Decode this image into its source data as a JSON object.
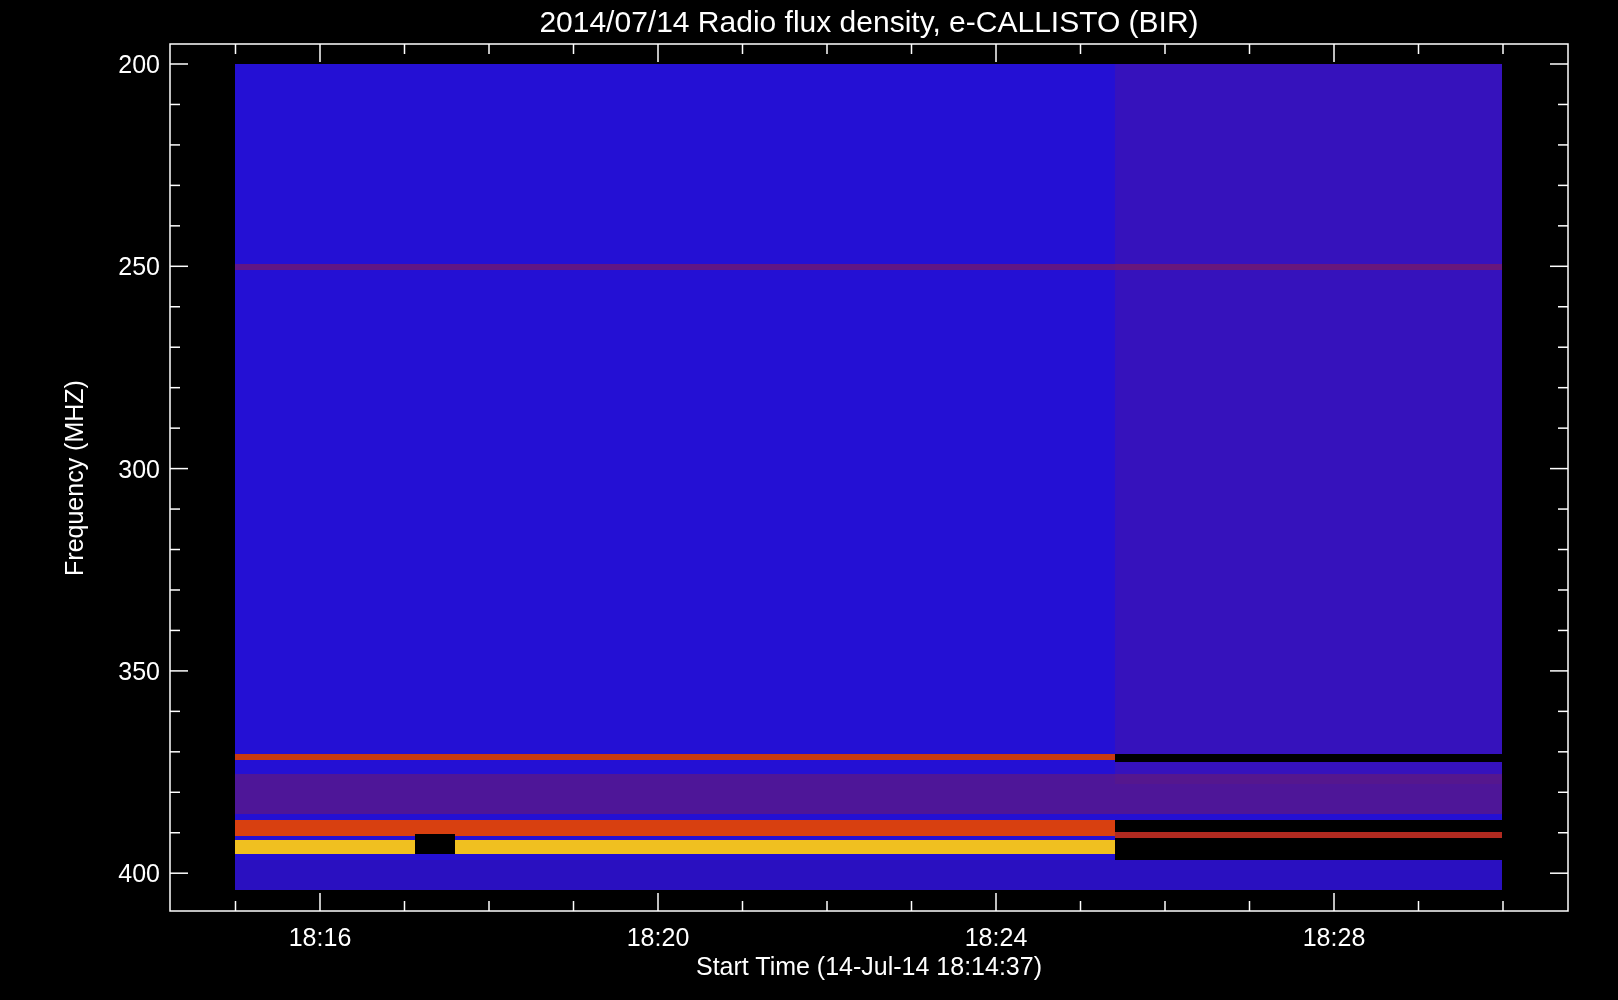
{
  "title": "2014/07/14  Radio flux density, e-CALLISTO (BIR)",
  "y_axis": {
    "label": "Frequency (MHZ)",
    "ticks": [
      "200",
      "250",
      "300",
      "350",
      "400"
    ]
  },
  "x_axis": {
    "label": "Start Time (14-Jul-14 18:14:37)",
    "ticks": [
      "18:16",
      "18:20",
      "18:24",
      "18:28"
    ]
  }
}
